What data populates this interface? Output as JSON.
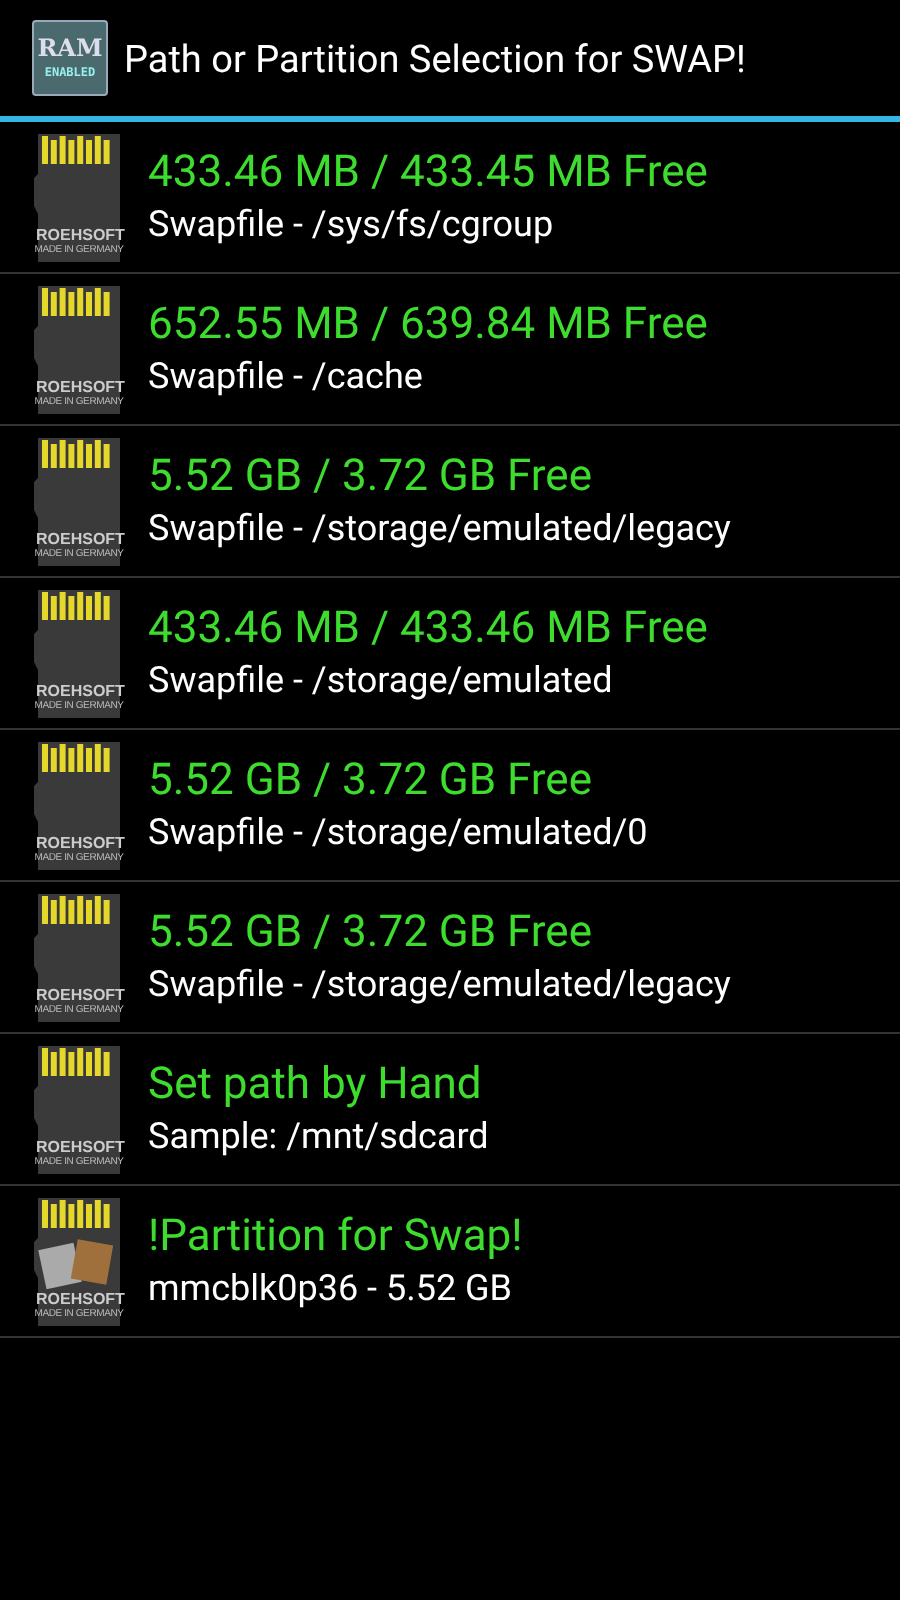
{
  "title_bar": {
    "title": "Path or Partition Selection for SWAP!",
    "app_icon": {
      "top": "RAM",
      "bottom": "ENABLED"
    }
  },
  "items": [
    {
      "kind": "card",
      "brand": "ROEHSOFT",
      "origin": "MADE IN GERMANY",
      "primary": "433.46 MB / 433.45 MB Free",
      "secondary": "Swapfile - /sys/fs/cgroup"
    },
    {
      "kind": "card",
      "brand": "ROEHSOFT",
      "origin": "MADE IN GERMANY",
      "primary": "652.55 MB / 639.84 MB Free",
      "secondary": "Swapfile - /cache"
    },
    {
      "kind": "card",
      "brand": "ROEHSOFT",
      "origin": "MADE IN GERMANY",
      "primary": "5.52 GB / 3.72 GB Free",
      "secondary": "Swapfile - /storage/emulated/legacy"
    },
    {
      "kind": "card",
      "brand": "ROEHSOFT",
      "origin": "MADE IN GERMANY",
      "primary": "433.46 MB / 433.46 MB Free",
      "secondary": "Swapfile - /storage/emulated"
    },
    {
      "kind": "card",
      "brand": "ROEHSOFT",
      "origin": "MADE IN GERMANY",
      "primary": "5.52 GB / 3.72 GB Free",
      "secondary": "Swapfile - /storage/emulated/0"
    },
    {
      "kind": "card",
      "brand": "ROEHSOFT",
      "origin": "MADE IN GERMANY",
      "primary": "5.52 GB / 3.72 GB Free",
      "secondary": "Swapfile - /storage/emulated/legacy"
    },
    {
      "kind": "card",
      "brand": "ROEHSOFT",
      "origin": "MADE IN GERMANY",
      "primary": "Set path by Hand",
      "secondary": "Sample: /mnt/sdcard"
    },
    {
      "kind": "partition",
      "brand": "ROEHSOFT",
      "origin": "MADE IN GERMANY",
      "primary": "!Partition for Swap!",
      "secondary": "mmcblk0p36 - 5.52 GB"
    }
  ]
}
